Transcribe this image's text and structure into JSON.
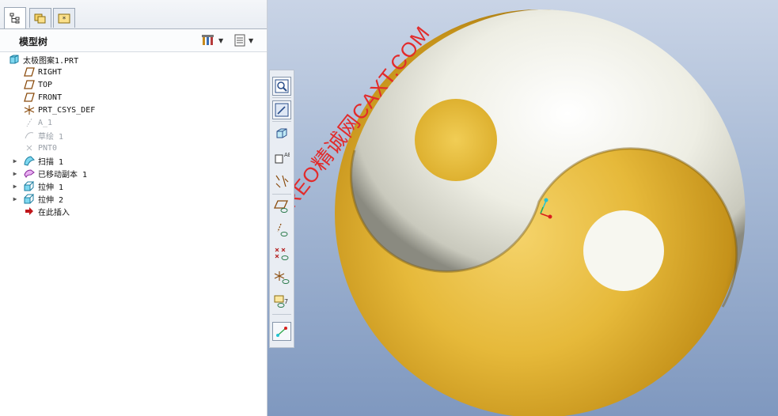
{
  "model_tree": {
    "title": "模型树",
    "tabs": [
      "model-tree-icon",
      "folder-browser-icon",
      "favorites-icon"
    ],
    "root": "太极图案1.PRT",
    "nodes": [
      {
        "label": "RIGHT",
        "icon": "datum-plane-icon",
        "dim": false,
        "expandable": false
      },
      {
        "label": "TOP",
        "icon": "datum-plane-icon",
        "dim": false,
        "expandable": false
      },
      {
        "label": "FRONT",
        "icon": "datum-plane-icon",
        "dim": false,
        "expandable": false
      },
      {
        "label": "PRT_CSYS_DEF",
        "icon": "coordinate-system-icon",
        "dim": false,
        "expandable": false
      },
      {
        "label": "A_1",
        "icon": "datum-axis-icon",
        "dim": true,
        "expandable": false
      },
      {
        "label": "草绘 1",
        "icon": "sketch-icon",
        "dim": true,
        "expandable": false
      },
      {
        "label": "PNT0",
        "icon": "datum-point-icon",
        "dim": true,
        "expandable": false
      },
      {
        "label": "扫描 1",
        "icon": "sweep-icon",
        "dim": false,
        "expandable": true
      },
      {
        "label": "已移动副本 1",
        "icon": "moved-copy-icon",
        "dim": false,
        "expandable": true
      },
      {
        "label": "拉伸 1",
        "icon": "extrude-icon",
        "dim": false,
        "expandable": true
      },
      {
        "label": "拉伸 2",
        "icon": "extrude-icon",
        "dim": false,
        "expandable": true
      },
      {
        "label": "在此插入",
        "icon": "insert-here-arrow-icon",
        "dim": false,
        "expandable": false
      }
    ]
  },
  "toolbar_icons": [
    "refit-icon",
    "repaint-icon",
    "saved-views-icon",
    "view-orientation-icon",
    "datum-display-icon",
    "plane-display-icon",
    "axis-display-icon",
    "point-display-icon",
    "csys-display-icon",
    "annotation-display-icon",
    "spin-center-icon"
  ],
  "watermark": "CREO精诚网CAXT.COM",
  "colors": {
    "gold": "#e0b42a",
    "pearl": "#f2f2ea",
    "viewport_top": "#c9d4e6",
    "viewport_bottom": "#7f98bf",
    "watermark": "#e22b2b"
  }
}
